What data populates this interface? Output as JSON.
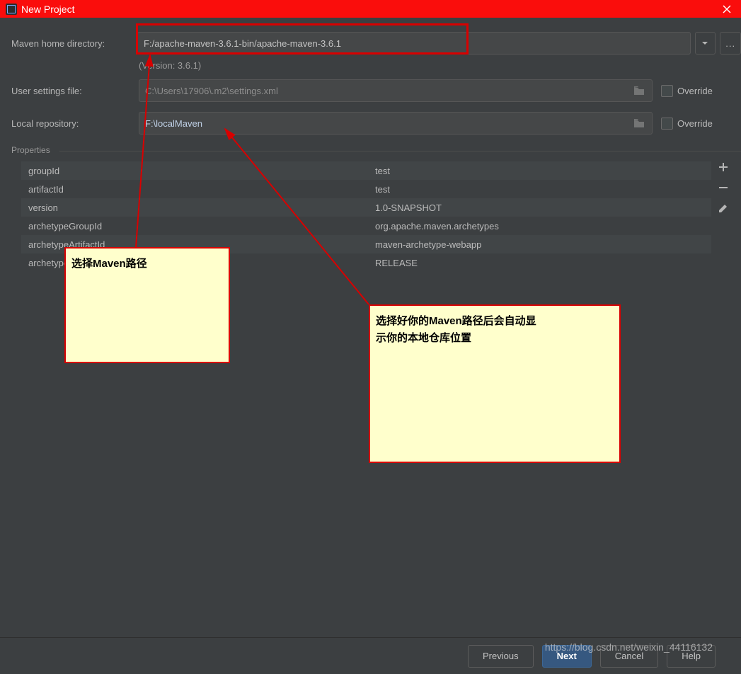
{
  "window": {
    "title": "New Project"
  },
  "mavenHome": {
    "label": "Maven home directory:",
    "value": "F:/apache-maven-3.6.1-bin/apache-maven-3.6.1",
    "version": "(Version: 3.6.1)"
  },
  "userSettings": {
    "label": "User settings file:",
    "value": "C:\\Users\\17906\\.m2\\settings.xml",
    "overrideLabel": "Override"
  },
  "localRepo": {
    "label": "Local repository:",
    "value": "F:\\localMaven",
    "overrideLabel": "Override"
  },
  "propertiesHeader": "Properties",
  "properties": [
    {
      "k": "groupId",
      "v": "test"
    },
    {
      "k": "artifactId",
      "v": "test"
    },
    {
      "k": "version",
      "v": "1.0-SNAPSHOT"
    },
    {
      "k": "archetypeGroupId",
      "v": "org.apache.maven.archetypes"
    },
    {
      "k": "archetypeArtifactId",
      "v": "maven-archetype-webapp"
    },
    {
      "k": "archetypeVersion",
      "v": "RELEASE"
    }
  ],
  "browseDots": "...",
  "annotations": {
    "a1": "选择Maven路径",
    "a2_line1": "选择好你的Maven路径后会自动显",
    "a2_line2": "示你的本地仓库位置"
  },
  "footer": {
    "previous": "Previous",
    "next": "Next",
    "cancel": "Cancel",
    "help": "Help"
  },
  "watermark": "https://blog.csdn.net/weixin_44116132"
}
